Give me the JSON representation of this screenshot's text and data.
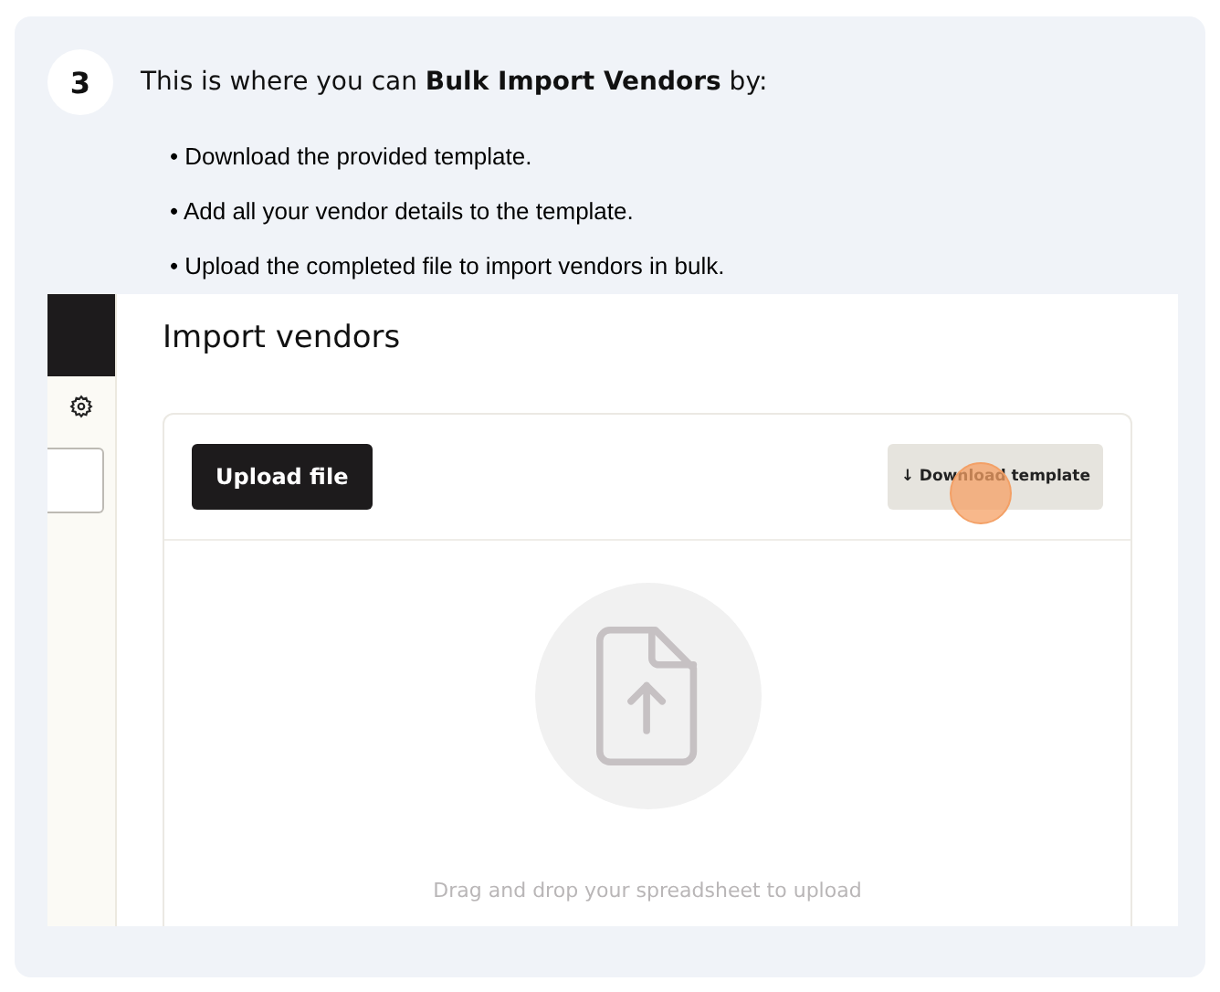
{
  "step": {
    "number": "3",
    "text": "This is where you can **Bulk Import Vendors** by:",
    "bullets": [
      "• Download the provided template.",
      "• Add all your vendor details to the template.",
      "• Upload the completed file to import vendors in bulk."
    ]
  },
  "screenshot": {
    "title": "Import vendors",
    "upload_button": "Upload file",
    "download_button": {
      "icon": "↓",
      "label": "Download template"
    },
    "dropzone_text": "Drag and drop your spreadsheet to upload"
  }
}
